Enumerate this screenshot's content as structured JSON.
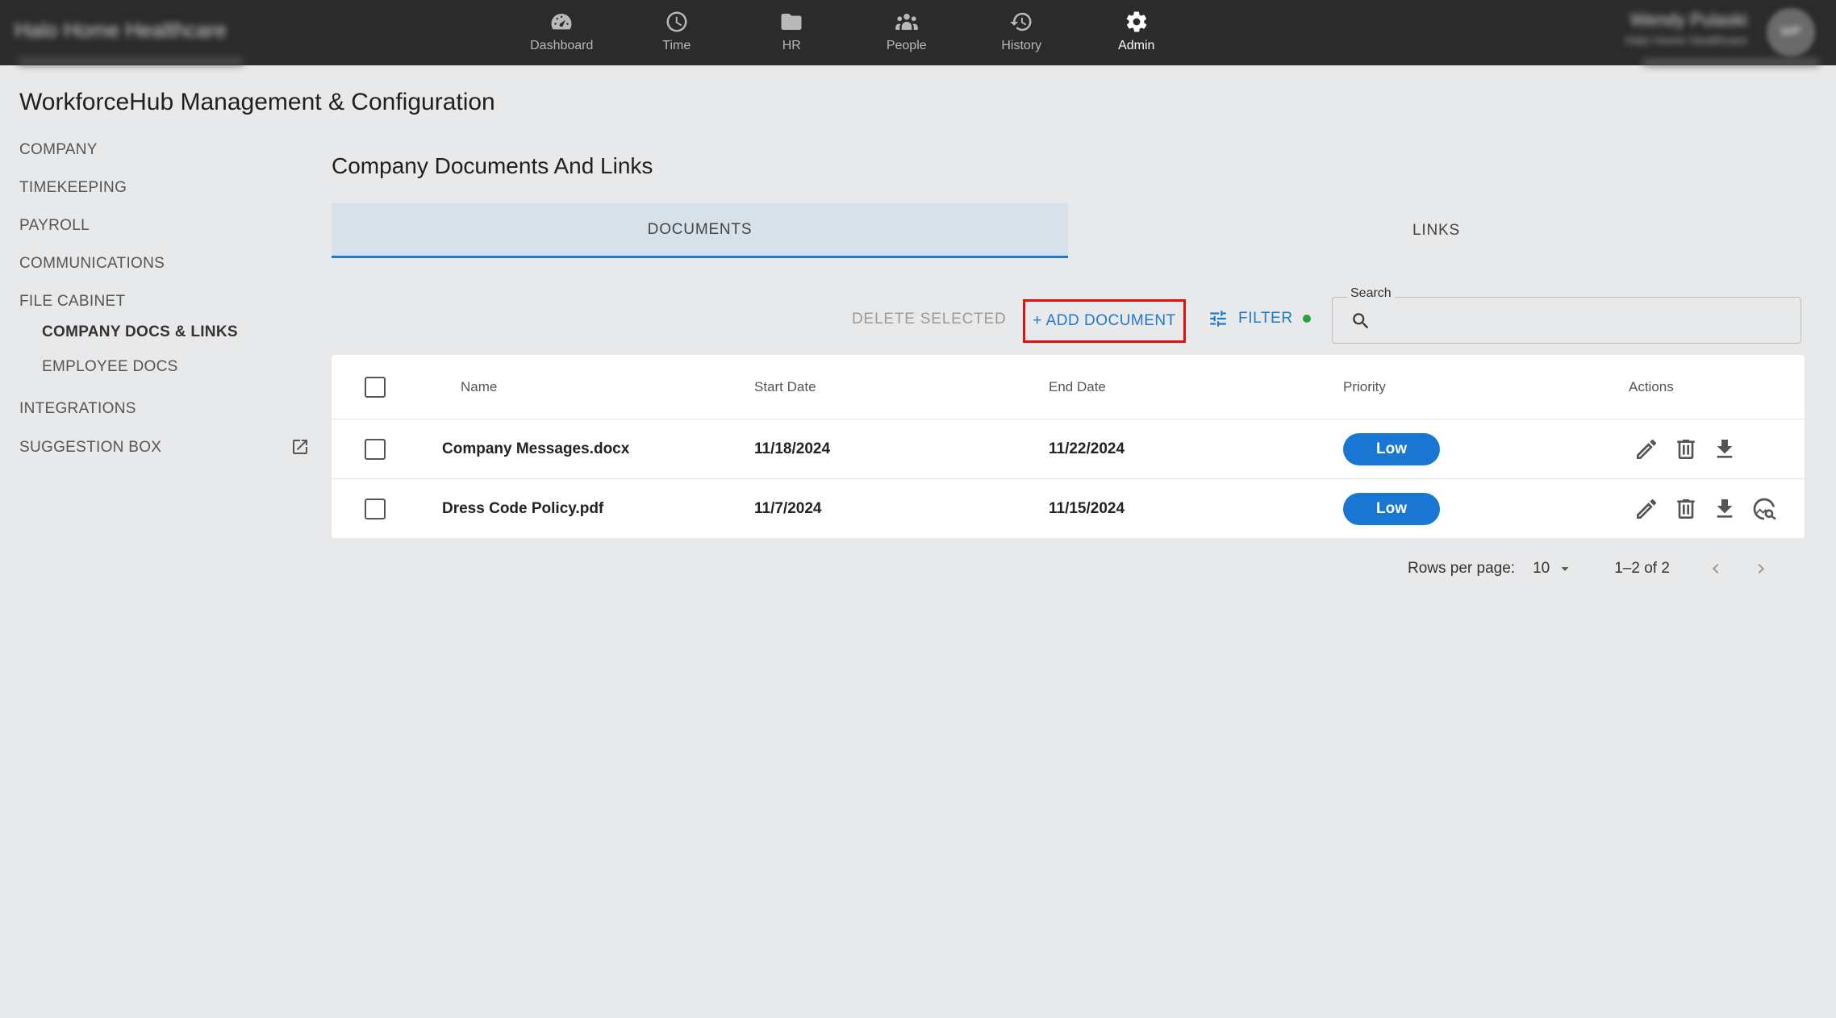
{
  "header": {
    "brand": "Halo Home Healthcare",
    "user_name": "Wendy Pulaski",
    "user_company": "Halo Home Healthcare",
    "user_initials": "WP",
    "nav": [
      {
        "label": "Dashboard",
        "icon": "dashboard-icon"
      },
      {
        "label": "Time",
        "icon": "clock-icon"
      },
      {
        "label": "HR",
        "icon": "folder-icon"
      },
      {
        "label": "People",
        "icon": "people-icon"
      },
      {
        "label": "History",
        "icon": "history-icon"
      },
      {
        "label": "Admin",
        "icon": "gear-icon",
        "active": true
      }
    ]
  },
  "page_title": "WorkforceHub Management & Configuration",
  "sidebar": {
    "items": [
      {
        "label": "COMPANY"
      },
      {
        "label": "TIMEKEEPING"
      },
      {
        "label": "PAYROLL"
      },
      {
        "label": "COMMUNICATIONS"
      },
      {
        "label": "FILE CABINET"
      },
      {
        "label": "COMPANY DOCS & LINKS",
        "active": true
      },
      {
        "label": "EMPLOYEE DOCS"
      },
      {
        "label": "INTEGRATIONS"
      },
      {
        "label": "SUGGESTION BOX",
        "icon": "external-link-icon"
      }
    ]
  },
  "main": {
    "section_title": "Company Documents And Links",
    "tabs": [
      {
        "label": "DOCUMENTS",
        "active": true
      },
      {
        "label": "LINKS"
      }
    ],
    "toolbar": {
      "delete_label": "DELETE SELECTED",
      "add_label": "+ ADD DOCUMENT",
      "filter_label": "FILTER",
      "search_label": "Search",
      "search_value": ""
    },
    "table": {
      "columns": [
        "Name",
        "Start Date",
        "End Date",
        "Priority",
        "Actions"
      ],
      "rows": [
        {
          "name": "Company Messages.docx",
          "start": "11/18/2024",
          "end": "11/22/2024",
          "priority": "Low"
        },
        {
          "name": "Dress Code Policy.pdf",
          "start": "11/7/2024",
          "end": "11/15/2024",
          "priority": "Low"
        }
      ]
    },
    "pagination": {
      "rows_per_page_label": "Rows per page:",
      "rows_per_page": "10",
      "range": "1–2 of 2"
    }
  },
  "colors": {
    "accent": "#1976d2",
    "highlight_border": "#e01010",
    "filter_dot": "#23a33c",
    "topbar": "#2b2b2b"
  }
}
